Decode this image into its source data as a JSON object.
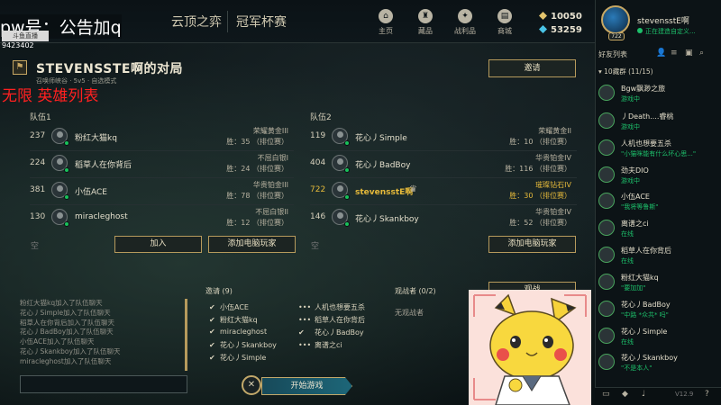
{
  "overlay": {
    "title": "pw号：公告加q",
    "logo_text": "斗鱼直播",
    "room_id": "9423402",
    "red_text": "无限 英雄列表"
  },
  "topbar": {
    "mode_tab1": "云顶之弈",
    "mode_tab2": "冠军杯赛",
    "nav": [
      {
        "label": "主页",
        "icon": "home-icon"
      },
      {
        "label": "藏品",
        "icon": "collection-icon"
      },
      {
        "label": "战利品",
        "icon": "loot-icon"
      },
      {
        "label": "商城",
        "icon": "store-icon"
      }
    ],
    "currency": [
      {
        "value": "10050",
        "icon": "blue-essence-icon",
        "color": "#e3c46d"
      },
      {
        "value": "53259",
        "icon": "rp-icon",
        "color": "#4ac4e6"
      }
    ]
  },
  "lobby": {
    "title": "STEVENSSTE啊的对局",
    "subtitle": "召唤师峡谷 · 5v5 · 自选模式",
    "invite_button": "邀请",
    "team1_label": "队伍1",
    "team2_label": "队伍2",
    "team1": [
      {
        "level": "237",
        "name": "粉红大猫kq",
        "rank": "荣耀黄金III",
        "wins": "胜：35 （排位赛）"
      },
      {
        "level": "224",
        "name": "稻草人在你背后",
        "rank": "不屈白银I",
        "wins": "胜：24 （排位赛）"
      },
      {
        "level": "381",
        "name": "小伍ACE",
        "rank": "华贵铂金III",
        "wins": "胜：78 （排位赛）"
      },
      {
        "level": "130",
        "name": "miracleghost",
        "rank": "不屈白银II",
        "wins": "胜：12 （排位赛）"
      }
    ],
    "team2": [
      {
        "level": "119",
        "name": "花心丿Simple",
        "rank": "荣耀黄金II",
        "wins": "胜：10 （排位赛）",
        "highlight": false
      },
      {
        "level": "404",
        "name": "花心丿BadBoy",
        "rank": "华贵铂金IV",
        "wins": "胜：116 （排位赛）",
        "highlight": false
      },
      {
        "level": "722",
        "name": "stevensstE啊",
        "rank": "璀璨钻石IV",
        "wins": "胜：30 （排位赛）",
        "highlight": true
      },
      {
        "level": "146",
        "name": "花心丿Skankboy",
        "rank": "华贵铂金IV",
        "wins": "胜：52 （排位赛）",
        "highlight": false
      }
    ],
    "empty_slot": "空",
    "join_button": "加入",
    "add_bot_button": "添加电脑玩家",
    "add_bot_button2": "添加电脑玩家",
    "right_button2": "观战"
  },
  "chat": {
    "lines": [
      "粉红大猫kq加入了队伍聊天",
      "花心丿Simple加入了队伍聊天",
      "稻草人在你背后加入了队伍聊天",
      "花心丿BadBoy加入了队伍聊天",
      "小伍ACE加入了队伍聊天",
      "花心丿Skankboy加入了队伍聊天",
      "miracleghost加入了队伍聊天"
    ],
    "input_placeholder": ""
  },
  "invites": {
    "title": "邀请 (9)",
    "accepted": [
      "小伍ACE",
      "粉红大猫kq",
      "miracleghost",
      "花心丿Skankboy",
      "花心丿Simple"
    ],
    "pending": [
      "人机也想要五杀",
      "稻草人在你背后",
      "花心丿BadBoy",
      "离谱之ci"
    ]
  },
  "spectators": {
    "title": "观战者 (0/2)",
    "none": "无观战者"
  },
  "start": {
    "close_glyph": "✕",
    "button": "开始游戏"
  },
  "profile": {
    "name": "stevensstE啊",
    "status": "正在建造自定义...",
    "level": "722"
  },
  "friends": {
    "header": "好友列表",
    "group": "▾ 10藏群 (11/15)",
    "list": [
      {
        "name": "Bgw飘渺之旅",
        "status": "游戏中"
      },
      {
        "name": "丿Death....睿桃",
        "status": "游戏中"
      },
      {
        "name": "人机也想要五杀",
        "status": "\"小猫咪能有什么坏心思...\""
      },
      {
        "name": "劲夫DIO",
        "status": "游戏中"
      },
      {
        "name": "小伍ACE",
        "status": "\"我将等鲁斯\""
      },
      {
        "name": "离谱之ci",
        "status": "在线"
      },
      {
        "name": "稻草人在你背后",
        "status": "在线"
      },
      {
        "name": "粉红大猫kq",
        "status": "\"要加加\""
      },
      {
        "name": "花心丿BadBoy",
        "status": "\"中路 *众共* 吗\""
      },
      {
        "name": "花心丿Simple",
        "status": "在线"
      },
      {
        "name": "花心丿Skankboy",
        "status": "\"不是本人\""
      }
    ],
    "version": "V12.9"
  }
}
